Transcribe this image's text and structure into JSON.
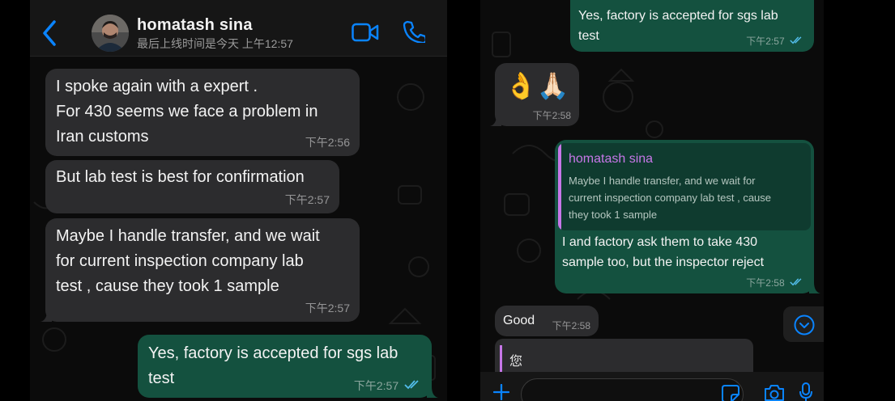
{
  "theme": {
    "accent": "#0a84ff",
    "outgoing_bubble": "#14513f",
    "incoming_bubble": "#2c2c2e",
    "read_ticks": "#53bdeb",
    "reply_name": "#c777e8"
  },
  "header": {
    "contact_name": "homatash sina",
    "last_seen": "最后上线时间是今天 上午12:57",
    "icons": [
      "back-chevron-icon",
      "video-camera-icon",
      "phone-icon"
    ]
  },
  "left_chat": {
    "messages": [
      {
        "direction": "incoming",
        "text": "I spoke again with a expert .\nFor 430 seems we face a problem in\nIran customs",
        "time": "下午2:56"
      },
      {
        "direction": "incoming",
        "text": "But lab test is best for confirmation",
        "time": "下午2:57"
      },
      {
        "direction": "incoming",
        "text": "Maybe I handle transfer,  and we wait\nfor current inspection company lab\ntest , cause they took 1 sample",
        "time": "下午2:57"
      },
      {
        "direction": "outgoing",
        "text": "Yes, factory is accepted for sgs lab\ntest",
        "time": "下午2:57",
        "status": "read"
      }
    ]
  },
  "right_chat": {
    "messages": [
      {
        "direction": "outgoing",
        "text": "Yes, factory is accepted for sgs lab\ntest",
        "time": "下午2:57",
        "status": "read"
      },
      {
        "direction": "incoming",
        "text": "👌🙏🏻",
        "time": "下午2:58"
      },
      {
        "direction": "outgoing",
        "reply_to": {
          "name": "homatash sina",
          "text": "Maybe I handle transfer,  and we wait for\ncurrent inspection company lab test , cause\nthey took 1 sample"
        },
        "text": "I and factory ask them to take 430\nsample too, but the inspector reject",
        "time": "下午2:58",
        "status": "read"
      },
      {
        "direction": "incoming",
        "text": "Good",
        "time": "下午2:58"
      }
    ],
    "quoted_preview": "您",
    "scroll_down_icon": "chevron-down-circle-icon"
  },
  "composer": {
    "value": "",
    "placeholder": "",
    "icons": [
      "plus-icon",
      "sticker-icon",
      "camera-icon",
      "microphone-icon"
    ]
  }
}
